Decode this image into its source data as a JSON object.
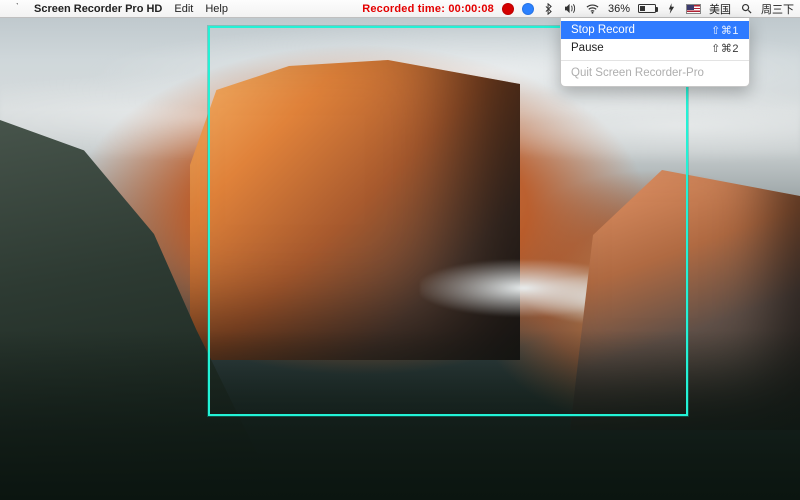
{
  "menubar": {
    "app_name": "Screen Recorder Pro HD",
    "menus": {
      "edit": "Edit",
      "help": "Help"
    },
    "recorded_label": "Recorded time: 00:00:08",
    "battery_percent": "36%",
    "input_label": "美国",
    "date_label": "周三下"
  },
  "icons": {
    "apple": "apple-icon",
    "rec_red": "record-red-icon",
    "rec_blue": "record-blue-icon",
    "bluetooth": "bluetooth-icon",
    "volume": "volume-icon",
    "wifi": "wifi-icon",
    "battery": "battery-icon",
    "charging": "charging-icon",
    "flag": "us-flag-icon",
    "search": "spotlight-icon"
  },
  "dropdown": {
    "items": [
      {
        "label": "Stop Record",
        "shortcut": "⇧⌘1",
        "selected": true,
        "enabled": true
      },
      {
        "label": "Pause",
        "shortcut": "⇧⌘2",
        "selected": false,
        "enabled": true
      }
    ],
    "quit_label": "Quit Screen Recorder-Pro"
  },
  "selection": {
    "color": "#23f2d6"
  }
}
